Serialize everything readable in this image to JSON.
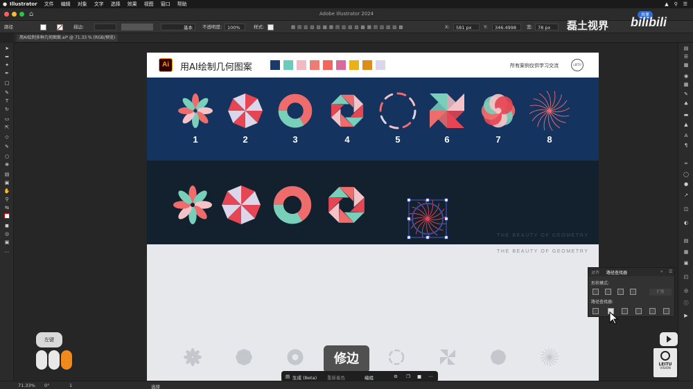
{
  "menubar": {
    "items": [
      "Illustrator",
      "文件",
      "编辑",
      "对象",
      "文字",
      "选择",
      "效果",
      "视图",
      "窗口",
      "帮助"
    ]
  },
  "window": {
    "title": "Adobe Illustrator 2024",
    "share_label": "共享"
  },
  "controlbar": {
    "selection_label": "路径",
    "stroke_label": "描边:",
    "stroke_style": "基本",
    "opacity_label": "不透明度:",
    "opacity_value": "100%",
    "style_label": "样式:",
    "x_label": "X:",
    "x_value": "581 px",
    "y_label": "Y:",
    "y_value": "346.4998",
    "w_label": "宽:",
    "w_value": "78 px"
  },
  "document_tab": {
    "label": "用AI绘制多种几何图案.ai* @ 71.33 % (RGB/预览)"
  },
  "artboard": {
    "title": "用AI绘制几何图案",
    "note": "所有案例仅供学习交流",
    "seal_text": "LEITU",
    "palette": [
      "#1b3a6b",
      "#6ccab8",
      "#f1b9c3",
      "#ef7b72",
      "#f2675d",
      "#d96b9c",
      "#eab217",
      "#d98f1a",
      "#dcd6eb"
    ],
    "numbers": [
      "1",
      "2",
      "3",
      "4",
      "5",
      "6",
      "7",
      "8"
    ],
    "tagline": "THE BEAUTY OF GEOMETRY",
    "colors": {
      "navy": "#14345f",
      "dark": "#13202d",
      "coral": "#ef6c6c",
      "mint": "#78cfba",
      "pink": "#f3c3c8",
      "lilac": "#dcd6eb",
      "red": "#e64553"
    }
  },
  "pathfinder": {
    "tab_align": "对齐",
    "tab_pathfinder": "路径查找器",
    "shape_modes": "形状模式:",
    "pathfinders": "路径查找器:",
    "expand": "扩展"
  },
  "statusbar": {
    "zoom": "71.33%",
    "rotate": "0°",
    "page": "1",
    "tool": "选择"
  },
  "contextbar": {
    "generate": "生成 (Beta)",
    "recolor": "重新着色",
    "group": "编组"
  },
  "overlay": {
    "caption": "修边",
    "key_hint": "左键",
    "watermark": "磊土视界",
    "bilibili": "bilibili",
    "leitu_label": "LEITU",
    "leitu_sub": "VISION"
  }
}
